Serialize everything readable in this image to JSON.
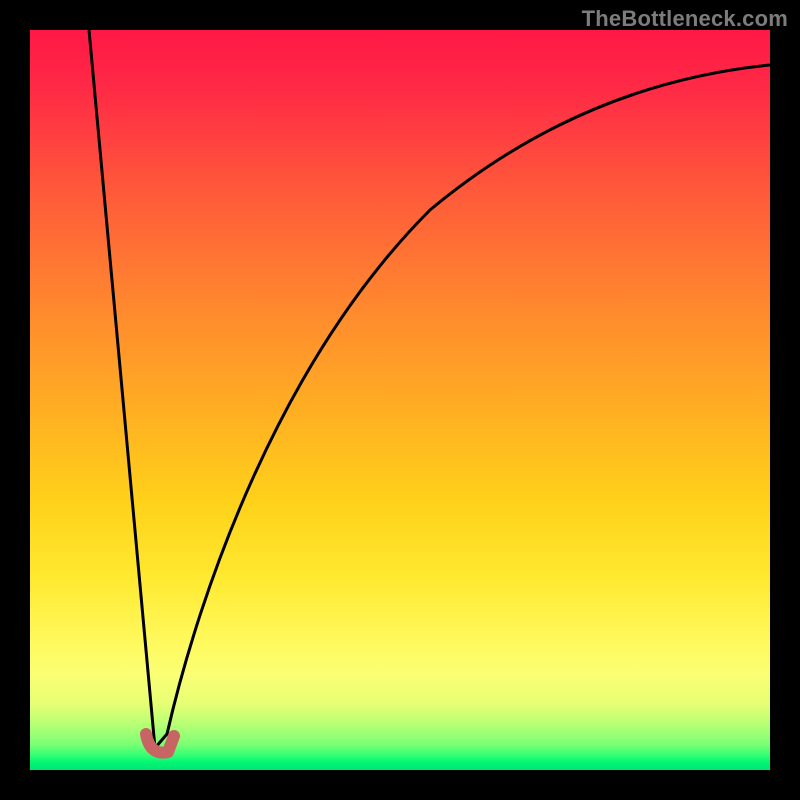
{
  "watermark": "TheBottleneck.com",
  "colors": {
    "frame": "#000000",
    "curve_stroke": "#000000",
    "marker": "#c86464",
    "gradient_top": "#ff1846",
    "gradient_bottom": "#00e574"
  },
  "chart_data": {
    "type": "line",
    "title": "",
    "xlabel": "",
    "ylabel": "",
    "xlim": [
      0,
      100
    ],
    "ylim": [
      0,
      100
    ],
    "grid": false,
    "legend": false,
    "note": "Axes unlabeled in source image; x/y are 0-100 relative to plot area; y=0 is bottom (good), y=100 is top (bad).",
    "series": [
      {
        "name": "left-descent",
        "x": [
          8.0,
          9.5,
          11.0,
          12.5,
          14.0,
          15.5,
          16.5
        ],
        "values": [
          100.0,
          87.0,
          74.0,
          60.0,
          46.0,
          30.0,
          15.0
        ]
      },
      {
        "name": "right-ascent",
        "x": [
          18.5,
          20.0,
          22.0,
          25.0,
          29.0,
          34.0,
          40.0,
          47.0,
          55.0,
          64.0,
          74.0,
          85.0,
          100.0
        ],
        "values": [
          5.0,
          15.0,
          28.0,
          42.0,
          54.0,
          64.0,
          72.0,
          78.5,
          83.5,
          87.5,
          90.5,
          93.0,
          95.0
        ]
      }
    ],
    "marker": {
      "name": "optimal-point",
      "shape": "J",
      "x": 17.5,
      "y": 3.0,
      "color": "#c86464",
      "stroke_width_px": 12
    }
  }
}
